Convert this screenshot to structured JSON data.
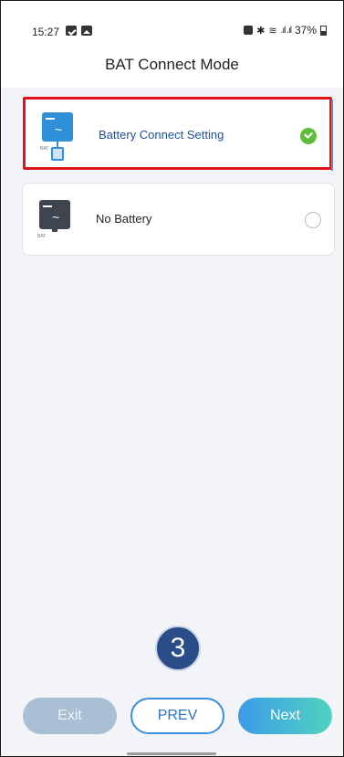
{
  "status_bar": {
    "time": "15:27",
    "battery_percent": "37%",
    "network": "Vo) LTE1"
  },
  "header": {
    "title": "BAT Connect Mode"
  },
  "options": [
    {
      "label": "Battery Connect Setting",
      "selected": true,
      "icon": "inverter-battery-icon",
      "tag": "BAT"
    },
    {
      "label": "No Battery",
      "selected": false,
      "icon": "inverter-icon",
      "tag": "BAT"
    }
  ],
  "step_marker": "3",
  "buttons": {
    "exit": "Exit",
    "prev": "PREV",
    "next": "Next"
  },
  "colors": {
    "accent": "#3a8fe0",
    "selected_check": "#5ebd3a",
    "highlight_border": "#e0141b",
    "step_badge": "#2a4d8a"
  }
}
